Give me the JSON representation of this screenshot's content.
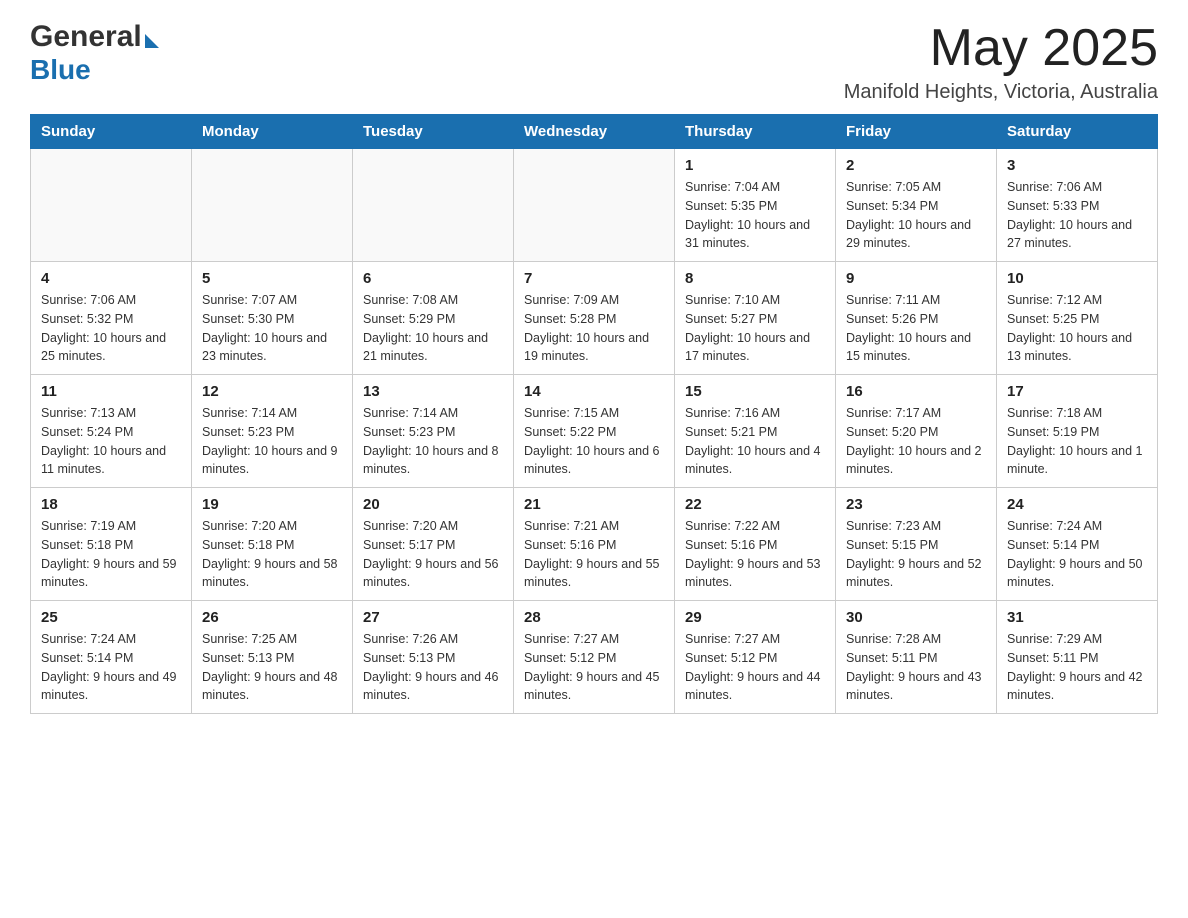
{
  "header": {
    "logo_general": "General",
    "logo_blue": "Blue",
    "month_title": "May 2025",
    "location": "Manifold Heights, Victoria, Australia"
  },
  "days_of_week": [
    "Sunday",
    "Monday",
    "Tuesday",
    "Wednesday",
    "Thursday",
    "Friday",
    "Saturday"
  ],
  "weeks": [
    {
      "days": [
        {
          "number": "",
          "info": ""
        },
        {
          "number": "",
          "info": ""
        },
        {
          "number": "",
          "info": ""
        },
        {
          "number": "",
          "info": ""
        },
        {
          "number": "1",
          "info": "Sunrise: 7:04 AM\nSunset: 5:35 PM\nDaylight: 10 hours and 31 minutes."
        },
        {
          "number": "2",
          "info": "Sunrise: 7:05 AM\nSunset: 5:34 PM\nDaylight: 10 hours and 29 minutes."
        },
        {
          "number": "3",
          "info": "Sunrise: 7:06 AM\nSunset: 5:33 PM\nDaylight: 10 hours and 27 minutes."
        }
      ]
    },
    {
      "days": [
        {
          "number": "4",
          "info": "Sunrise: 7:06 AM\nSunset: 5:32 PM\nDaylight: 10 hours and 25 minutes."
        },
        {
          "number": "5",
          "info": "Sunrise: 7:07 AM\nSunset: 5:30 PM\nDaylight: 10 hours and 23 minutes."
        },
        {
          "number": "6",
          "info": "Sunrise: 7:08 AM\nSunset: 5:29 PM\nDaylight: 10 hours and 21 minutes."
        },
        {
          "number": "7",
          "info": "Sunrise: 7:09 AM\nSunset: 5:28 PM\nDaylight: 10 hours and 19 minutes."
        },
        {
          "number": "8",
          "info": "Sunrise: 7:10 AM\nSunset: 5:27 PM\nDaylight: 10 hours and 17 minutes."
        },
        {
          "number": "9",
          "info": "Sunrise: 7:11 AM\nSunset: 5:26 PM\nDaylight: 10 hours and 15 minutes."
        },
        {
          "number": "10",
          "info": "Sunrise: 7:12 AM\nSunset: 5:25 PM\nDaylight: 10 hours and 13 minutes."
        }
      ]
    },
    {
      "days": [
        {
          "number": "11",
          "info": "Sunrise: 7:13 AM\nSunset: 5:24 PM\nDaylight: 10 hours and 11 minutes."
        },
        {
          "number": "12",
          "info": "Sunrise: 7:14 AM\nSunset: 5:23 PM\nDaylight: 10 hours and 9 minutes."
        },
        {
          "number": "13",
          "info": "Sunrise: 7:14 AM\nSunset: 5:23 PM\nDaylight: 10 hours and 8 minutes."
        },
        {
          "number": "14",
          "info": "Sunrise: 7:15 AM\nSunset: 5:22 PM\nDaylight: 10 hours and 6 minutes."
        },
        {
          "number": "15",
          "info": "Sunrise: 7:16 AM\nSunset: 5:21 PM\nDaylight: 10 hours and 4 minutes."
        },
        {
          "number": "16",
          "info": "Sunrise: 7:17 AM\nSunset: 5:20 PM\nDaylight: 10 hours and 2 minutes."
        },
        {
          "number": "17",
          "info": "Sunrise: 7:18 AM\nSunset: 5:19 PM\nDaylight: 10 hours and 1 minute."
        }
      ]
    },
    {
      "days": [
        {
          "number": "18",
          "info": "Sunrise: 7:19 AM\nSunset: 5:18 PM\nDaylight: 9 hours and 59 minutes."
        },
        {
          "number": "19",
          "info": "Sunrise: 7:20 AM\nSunset: 5:18 PM\nDaylight: 9 hours and 58 minutes."
        },
        {
          "number": "20",
          "info": "Sunrise: 7:20 AM\nSunset: 5:17 PM\nDaylight: 9 hours and 56 minutes."
        },
        {
          "number": "21",
          "info": "Sunrise: 7:21 AM\nSunset: 5:16 PM\nDaylight: 9 hours and 55 minutes."
        },
        {
          "number": "22",
          "info": "Sunrise: 7:22 AM\nSunset: 5:16 PM\nDaylight: 9 hours and 53 minutes."
        },
        {
          "number": "23",
          "info": "Sunrise: 7:23 AM\nSunset: 5:15 PM\nDaylight: 9 hours and 52 minutes."
        },
        {
          "number": "24",
          "info": "Sunrise: 7:24 AM\nSunset: 5:14 PM\nDaylight: 9 hours and 50 minutes."
        }
      ]
    },
    {
      "days": [
        {
          "number": "25",
          "info": "Sunrise: 7:24 AM\nSunset: 5:14 PM\nDaylight: 9 hours and 49 minutes."
        },
        {
          "number": "26",
          "info": "Sunrise: 7:25 AM\nSunset: 5:13 PM\nDaylight: 9 hours and 48 minutes."
        },
        {
          "number": "27",
          "info": "Sunrise: 7:26 AM\nSunset: 5:13 PM\nDaylight: 9 hours and 46 minutes."
        },
        {
          "number": "28",
          "info": "Sunrise: 7:27 AM\nSunset: 5:12 PM\nDaylight: 9 hours and 45 minutes."
        },
        {
          "number": "29",
          "info": "Sunrise: 7:27 AM\nSunset: 5:12 PM\nDaylight: 9 hours and 44 minutes."
        },
        {
          "number": "30",
          "info": "Sunrise: 7:28 AM\nSunset: 5:11 PM\nDaylight: 9 hours and 43 minutes."
        },
        {
          "number": "31",
          "info": "Sunrise: 7:29 AM\nSunset: 5:11 PM\nDaylight: 9 hours and 42 minutes."
        }
      ]
    }
  ]
}
